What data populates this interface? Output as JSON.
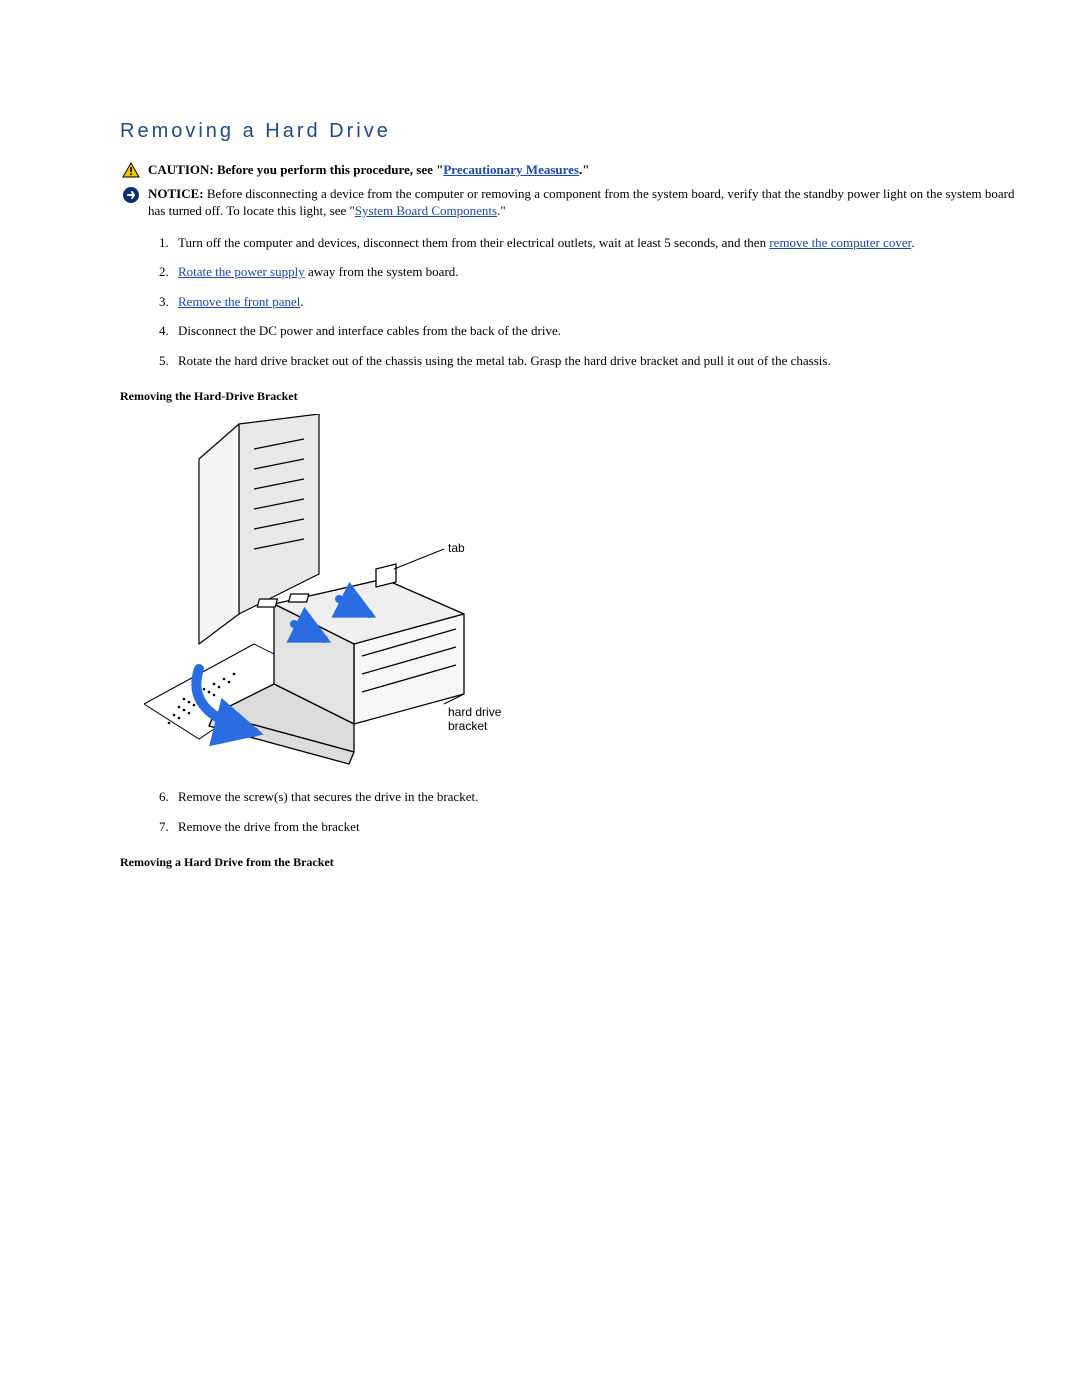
{
  "title": "Removing a Hard Drive",
  "caution": {
    "label": "CAUTION:",
    "before": " Before you perform this procedure, see \"",
    "link": "Precautionary Measures",
    "after": ".\""
  },
  "notice": {
    "label": "NOTICE:",
    "before": " Before disconnecting a device from the computer or removing a component from the system board, verify that the standby power light on the system board has turned off. To locate this light, see \"",
    "link": "System Board Components",
    "after": ".\""
  },
  "steps_a": [
    {
      "num": "1.",
      "pre": "Turn off the computer and devices, disconnect them from their electrical outlets, wait at least 5 seconds, and then ",
      "link": "remove the computer cover",
      "post": "."
    },
    {
      "num": "2.",
      "pre": "",
      "link": "Rotate the power supply",
      "post": " away from the system board."
    },
    {
      "num": "3.",
      "pre": "",
      "link": "Remove the front panel",
      "post": "."
    },
    {
      "num": "4.",
      "pre": "Disconnect the DC power and interface cables from the back of the drive.",
      "link": "",
      "post": ""
    },
    {
      "num": "5.",
      "pre": "Rotate the hard drive bracket out of the chassis using the metal tab. Grasp the hard drive bracket and pull it out of the chassis.",
      "link": "",
      "post": ""
    }
  ],
  "sub1": "Removing the Hard-Drive Bracket",
  "figure": {
    "label_tab": "tab",
    "label_bracket_line1": "hard drive",
    "label_bracket_line2": "bracket"
  },
  "steps_b": [
    {
      "num": "6.",
      "text": "Remove the screw(s) that secures the drive in the bracket."
    },
    {
      "num": "7.",
      "text": "Remove the drive from the bracket"
    }
  ],
  "sub2": "Removing a Hard Drive from the Bracket"
}
